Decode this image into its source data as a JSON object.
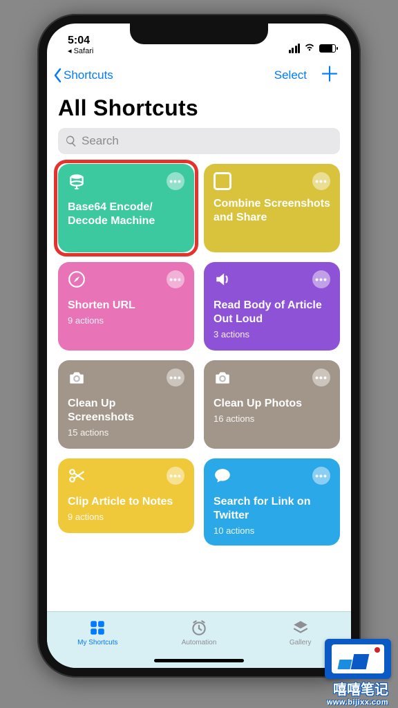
{
  "status_bar": {
    "time": "5:04",
    "back_app": "◂ Safari"
  },
  "nav": {
    "back_label": "Shortcuts",
    "select_label": "Select",
    "plus_label": "＋"
  },
  "page_title": "All Shortcuts",
  "search": {
    "placeholder": "Search"
  },
  "shortcuts": [
    {
      "title": "Base64 Encode/\nDecode Machine",
      "subtitle": "",
      "color": "#3cc9a0",
      "icon": "disk",
      "highlighted": true
    },
    {
      "title": "Combine Screenshots and Share",
      "subtitle": "",
      "color": "#d9c23c",
      "icon": "box",
      "highlighted": false
    },
    {
      "title": "Shorten URL",
      "subtitle": "9 actions",
      "color": "#e873b6",
      "icon": "compass",
      "highlighted": false
    },
    {
      "title": "Read Body of Article Out Loud",
      "subtitle": "3 actions",
      "color": "#8e52d6",
      "icon": "speaker",
      "highlighted": false
    },
    {
      "title": "Clean Up Screenshots",
      "subtitle": "15 actions",
      "color": "#a19689",
      "icon": "camera",
      "highlighted": false
    },
    {
      "title": "Clean Up Photos",
      "subtitle": "16 actions",
      "color": "#a19689",
      "icon": "camera",
      "highlighted": false
    },
    {
      "title": "Clip Article to Notes",
      "subtitle": "9 actions",
      "color": "#f0c93a",
      "icon": "scissors",
      "highlighted": false
    },
    {
      "title": "Search for Link on Twitter",
      "subtitle": "10 actions",
      "color": "#2aa8e8",
      "icon": "speech",
      "highlighted": false
    }
  ],
  "tabs": [
    {
      "label": "My Shortcuts",
      "icon": "grid",
      "active": true
    },
    {
      "label": "Automation",
      "icon": "clock",
      "active": false
    },
    {
      "label": "Gallery",
      "icon": "layers",
      "active": false
    }
  ],
  "watermark": {
    "cn": "嘻嘻笔记",
    "url": "www.bijixx.com"
  }
}
